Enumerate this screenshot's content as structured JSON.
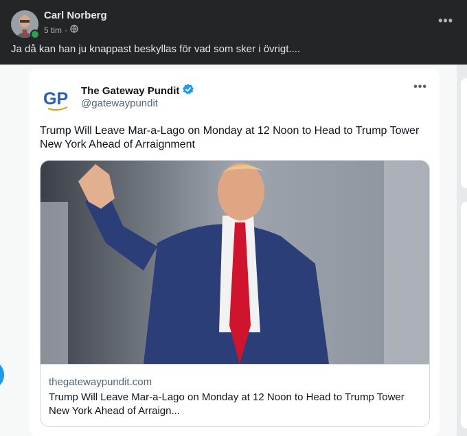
{
  "post": {
    "author": "Carl Norberg",
    "time": "5 tim",
    "separator": "·",
    "more": "•••",
    "text": "Ja då kan han ju knappast beskyllas för vad som sker i övrigt...."
  },
  "tweet": {
    "name": "The Gateway Pundit",
    "handle": "@gatewaypundit",
    "more": "•••",
    "logo_text": "GP",
    "text": "Trump Will Leave Mar-a-Lago on Monday at 12 Noon to Head to Trump Tower New York Ahead of Arraignment",
    "link": {
      "domain": "thegatewaypundit.com",
      "title": "Trump Will Leave Mar-a-Lago on Monday at 12 Noon to Head to Trump Tower New York Ahead of Arraign..."
    }
  },
  "colors": {
    "facebook_bg": "#242526",
    "twitter_blue": "#1d9bf0",
    "logo_blue": "#2a5db0",
    "online_green": "#31a24c"
  },
  "icons": [
    "globe-icon",
    "verified-badge-icon",
    "more-options-icon"
  ]
}
